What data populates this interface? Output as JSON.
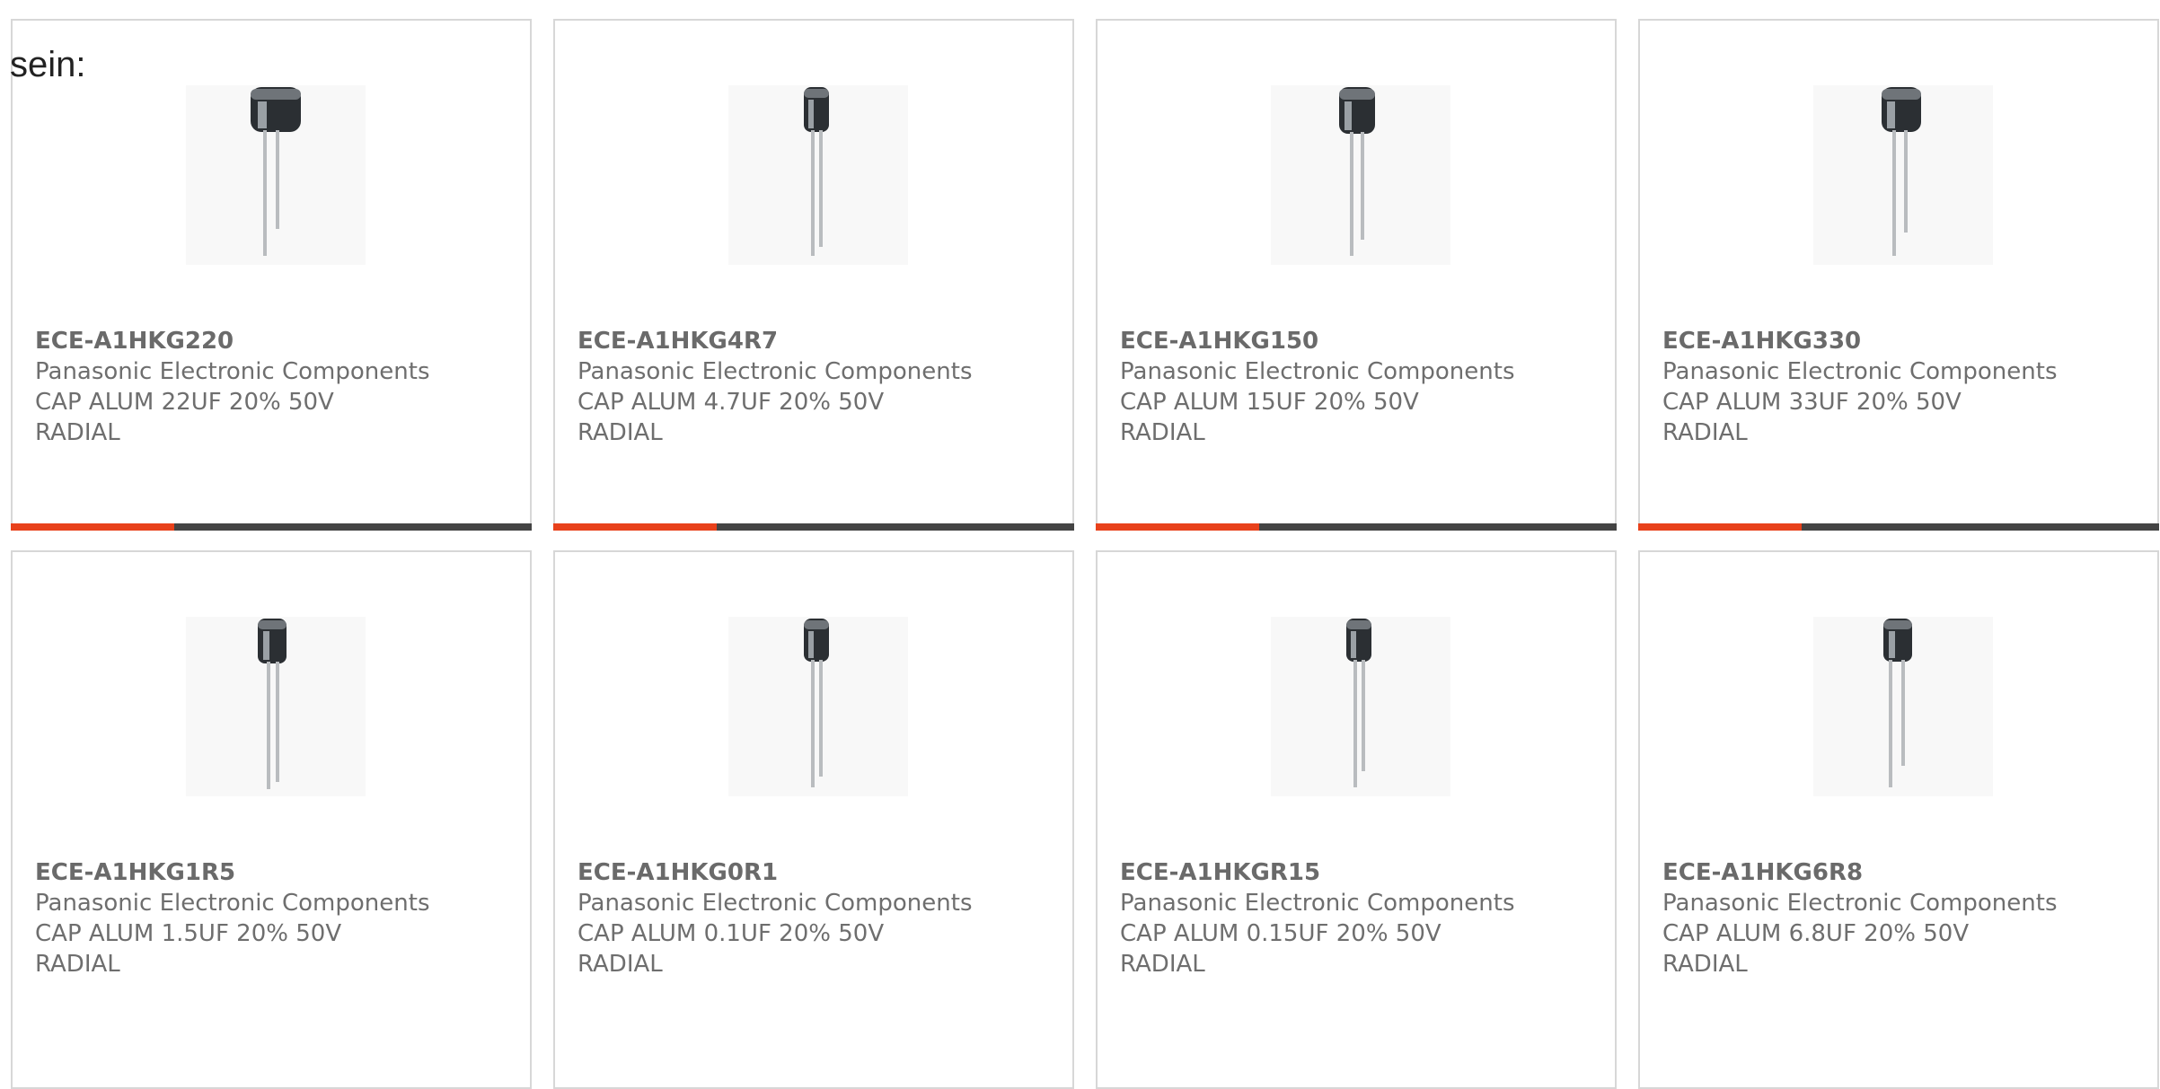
{
  "intro_text": "sein:",
  "colors": {
    "card_border": "#d7d7d7",
    "text": "#6e6e6e",
    "bar_dark": "#444444",
    "bar_accent": "#e8411b"
  },
  "products": [
    {
      "part_number": "ECE-A1HKG220",
      "manufacturer": "Panasonic Electronic Components",
      "description": "CAP ALUM 22UF 20% 50V",
      "package": "RADIAL",
      "image_icon": "radial-capacitor-icon"
    },
    {
      "part_number": "ECE-A1HKG4R7",
      "manufacturer": "Panasonic Electronic Components",
      "description": "CAP ALUM 4.7UF 20% 50V",
      "package": "RADIAL",
      "image_icon": "radial-capacitor-icon"
    },
    {
      "part_number": "ECE-A1HKG150",
      "manufacturer": "Panasonic Electronic Components",
      "description": "CAP ALUM 15UF 20% 50V",
      "package": "RADIAL",
      "image_icon": "radial-capacitor-icon"
    },
    {
      "part_number": "ECE-A1HKG330",
      "manufacturer": "Panasonic Electronic Components",
      "description": "CAP ALUM 33UF 20% 50V",
      "package": "RADIAL",
      "image_icon": "radial-capacitor-icon"
    },
    {
      "part_number": "ECE-A1HKG1R5",
      "manufacturer": "Panasonic Electronic Components",
      "description": "CAP ALUM 1.5UF 20% 50V",
      "package": "RADIAL",
      "image_icon": "radial-capacitor-icon"
    },
    {
      "part_number": "ECE-A1HKG0R1",
      "manufacturer": "Panasonic Electronic Components",
      "description": "CAP ALUM 0.1UF 20% 50V",
      "package": "RADIAL",
      "image_icon": "radial-capacitor-icon"
    },
    {
      "part_number": "ECE-A1HKGR15",
      "manufacturer": "Panasonic Electronic Components",
      "description": "CAP ALUM 0.15UF 20% 50V",
      "package": "RADIAL",
      "image_icon": "radial-capacitor-icon"
    },
    {
      "part_number": "ECE-A1HKG6R8",
      "manufacturer": "Panasonic Electronic Components",
      "description": "CAP ALUM 6.8UF 20% 50V",
      "package": "RADIAL",
      "image_icon": "radial-capacitor-icon"
    }
  ]
}
